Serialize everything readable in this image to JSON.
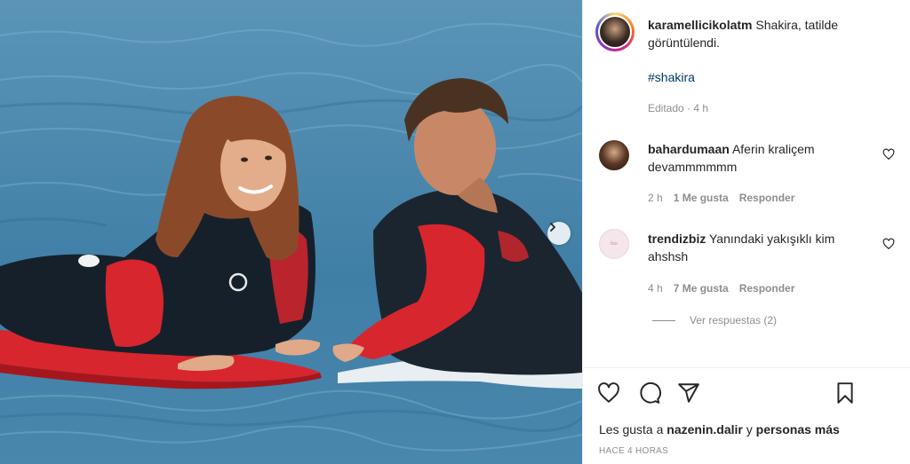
{
  "post": {
    "author": "karamellicikolatm",
    "caption_text": "Shakira, tatilde görüntülendi.",
    "hashtag": "#shakira",
    "edited_label": "Editado",
    "edited_time": "4 h",
    "likes_prefix": "Les gusta a",
    "likes_user": "nazenin.dalir",
    "likes_and": "y",
    "likes_others": "personas más",
    "timestamp": "HACE 4 HORAS"
  },
  "comments": [
    {
      "username": "bahardumaan",
      "text": "Aferin kraliçem devammmmmm",
      "time": "2 h",
      "likes": "1 Me gusta",
      "reply_label": "Responder"
    },
    {
      "username": "trendizbiz",
      "text": "Yanındaki yakışıklı kim ahshsh",
      "time": "4 h",
      "likes": "7 Me gusta",
      "reply_label": "Responder",
      "view_replies": "Ver respuestas (2)"
    }
  ],
  "icons": {
    "like": "heart-icon",
    "comment": "comment-icon",
    "share": "share-icon",
    "save": "bookmark-icon",
    "next": "chevron-right-icon"
  },
  "colors": {
    "text": "#262626",
    "muted": "#8e8e8e",
    "hashtag": "#00376b",
    "wetsuit_red": "#d7262d",
    "water": "#4c88ad"
  }
}
